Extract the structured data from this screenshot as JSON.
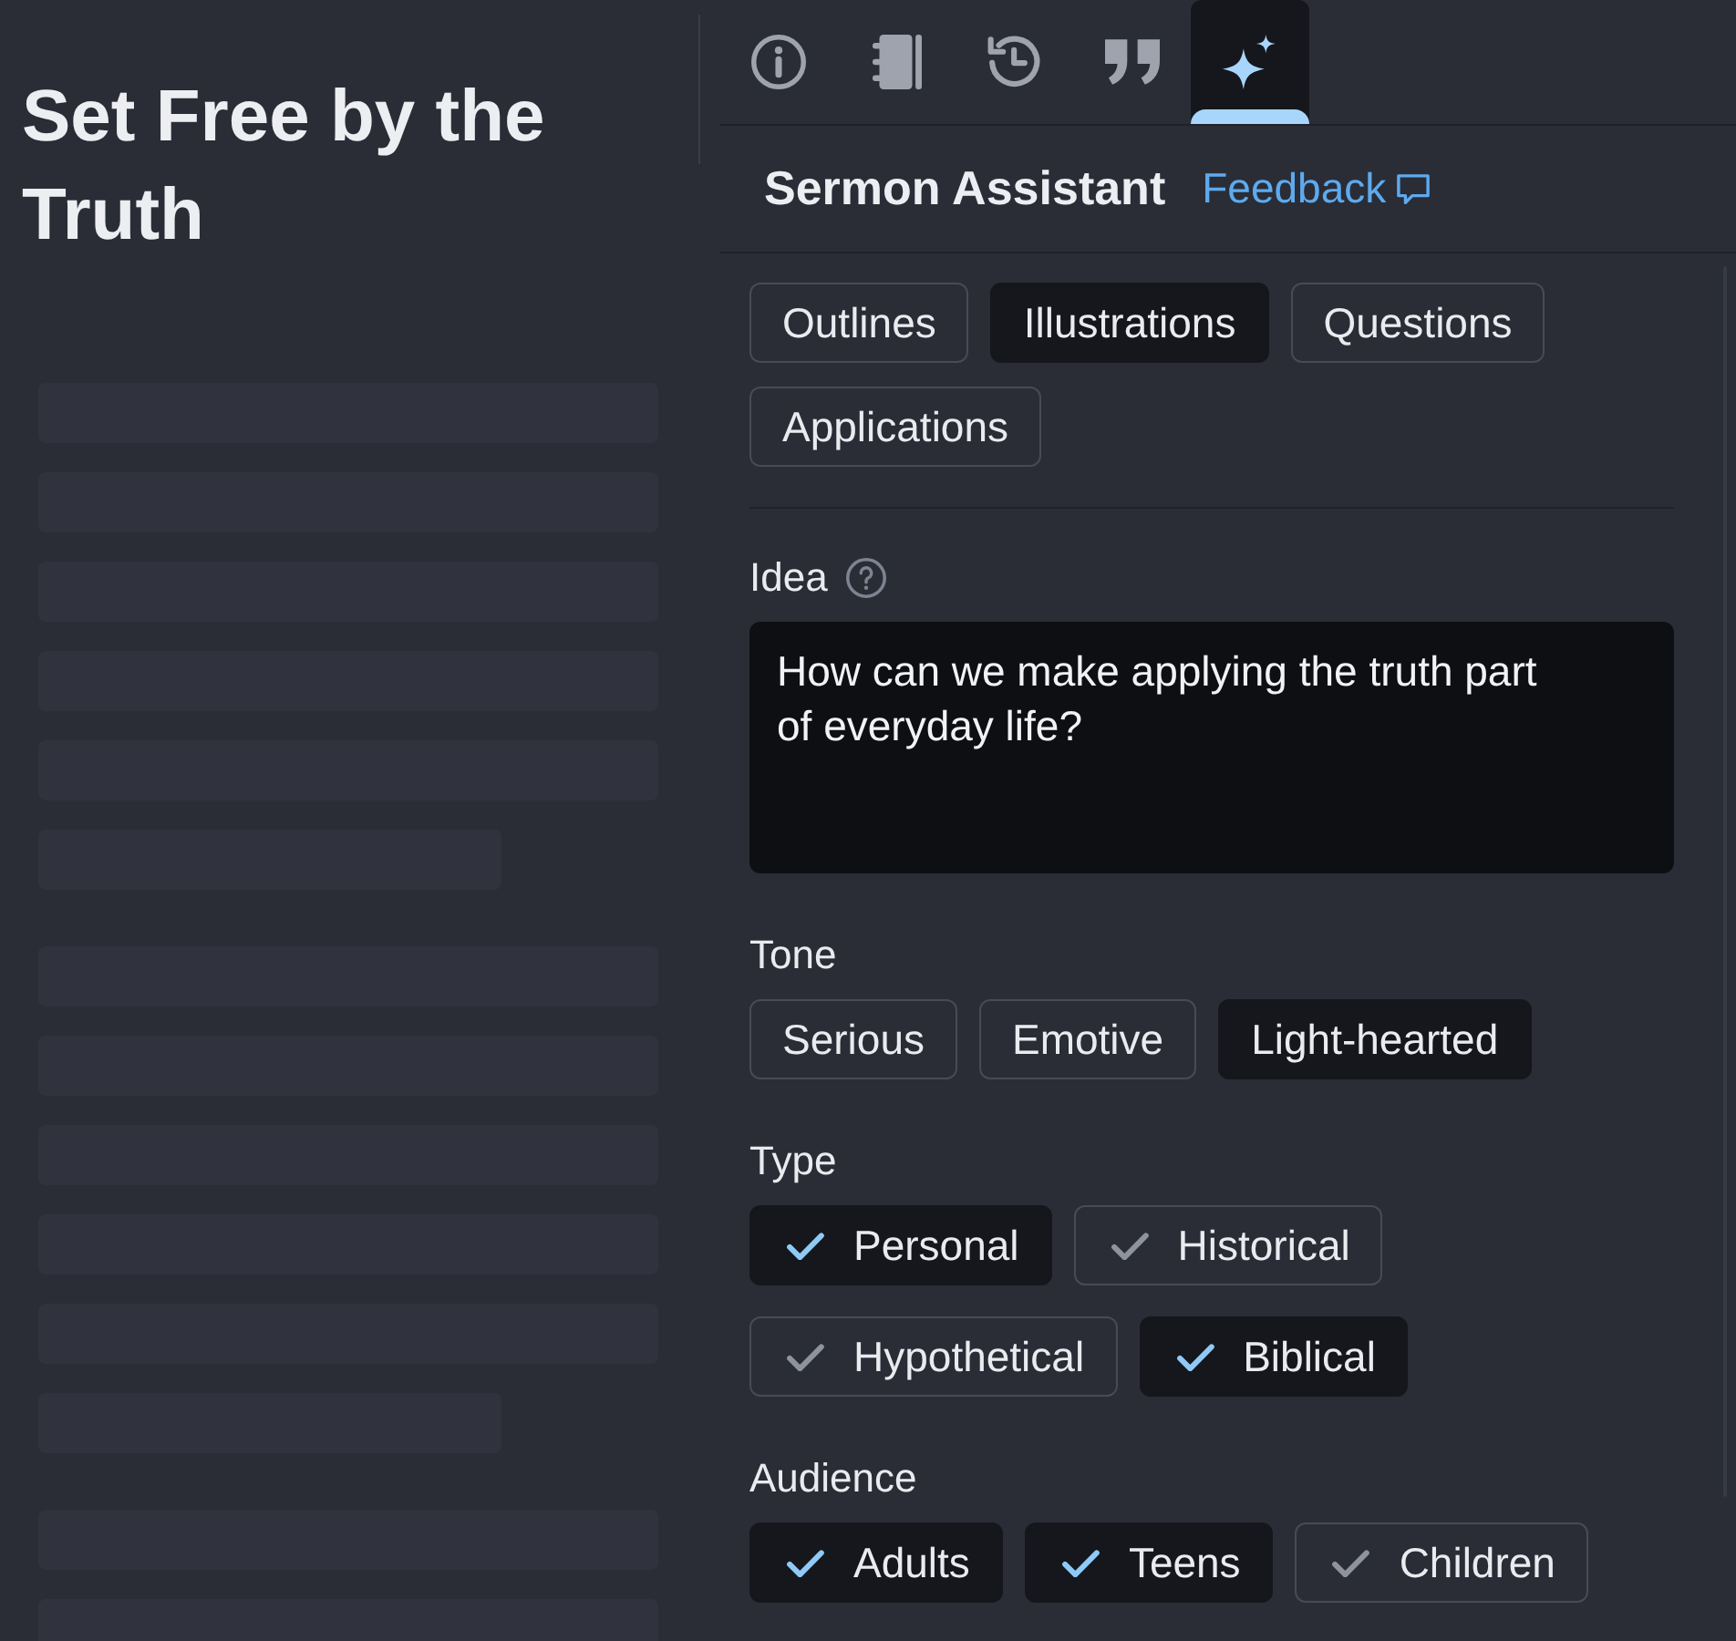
{
  "document": {
    "title": "Set Free by the Truth",
    "placeholder_paragraphs": [
      {
        "lines": [
          {
            "kind": "full"
          },
          {
            "kind": "full"
          },
          {
            "kind": "full"
          },
          {
            "kind": "full"
          },
          {
            "kind": "full"
          },
          {
            "kind": "short"
          }
        ]
      },
      {
        "lines": [
          {
            "kind": "full"
          },
          {
            "kind": "full"
          },
          {
            "kind": "full"
          },
          {
            "kind": "full"
          },
          {
            "kind": "full"
          },
          {
            "kind": "short"
          }
        ]
      },
      {
        "lines": [
          {
            "kind": "full"
          },
          {
            "kind": "full"
          }
        ]
      }
    ]
  },
  "tabs": [
    {
      "kind": "info",
      "selected": false
    },
    {
      "kind": "notebook",
      "selected": false
    },
    {
      "kind": "history",
      "selected": false
    },
    {
      "kind": "quotes",
      "selected": false
    },
    {
      "kind": "assistant",
      "selected": true
    }
  ],
  "panel": {
    "title": "Sermon Assistant",
    "feedback_link": "Feedback"
  },
  "modes": [
    {
      "label": "Outlines",
      "selected": false
    },
    {
      "label": "Illustrations",
      "selected": true
    },
    {
      "label": "Questions",
      "selected": false
    },
    {
      "label": "Applications",
      "selected": false
    }
  ],
  "idea": {
    "label": "Idea",
    "value": "How can we make applying the truth part of everyday life?"
  },
  "tone": {
    "label": "Tone",
    "options": [
      {
        "label": "Serious",
        "selected": false
      },
      {
        "label": "Emotive",
        "selected": false
      },
      {
        "label": "Light-hearted",
        "selected": true
      }
    ]
  },
  "type": {
    "label": "Type",
    "options": [
      {
        "label": "Personal",
        "checked": true
      },
      {
        "label": "Historical",
        "checked": false
      },
      {
        "label": "Hypothetical",
        "checked": false
      },
      {
        "label": "Biblical",
        "checked": true
      }
    ]
  },
  "audience": {
    "label": "Audience",
    "options": [
      {
        "label": "Adults",
        "checked": true
      },
      {
        "label": "Teens",
        "checked": true
      },
      {
        "label": "Children",
        "checked": false
      }
    ]
  }
}
